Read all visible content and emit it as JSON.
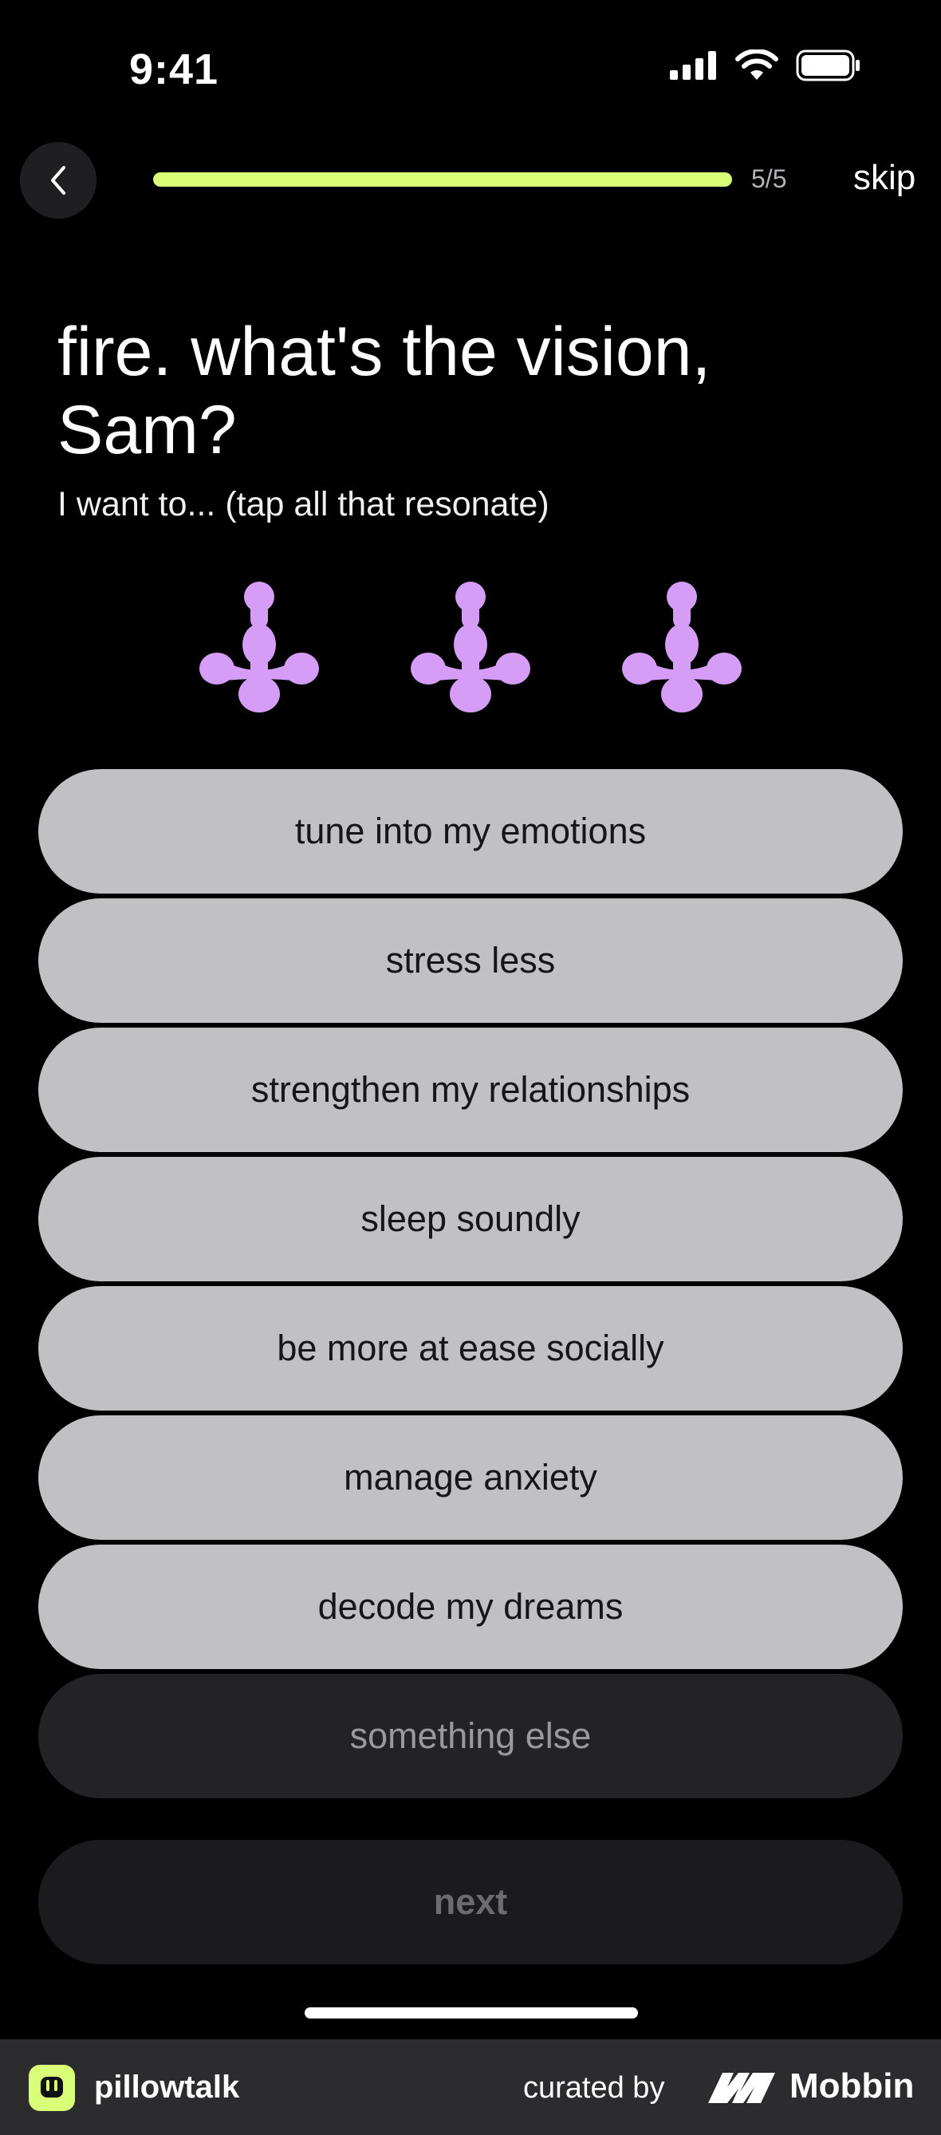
{
  "status_bar": {
    "time": "9:41"
  },
  "header": {
    "progress_text": "5/5",
    "progress_fraction": 1.0,
    "skip_label": "skip"
  },
  "main": {
    "title": "fire. what's the vision, Sam?",
    "subtitle": "I want to... (tap all that resonate)",
    "options": [
      "tune into my emotions",
      "stress less",
      "strengthen my relationships",
      "sleep soundly",
      "be more at ease socially",
      "manage anxiety",
      "decode my dreams",
      "something else"
    ],
    "next_label": "next"
  },
  "footer": {
    "app_name": "pillowtalk",
    "curated_label": "curated by",
    "brand": "Mobbin"
  },
  "colors": {
    "accent": "#d9ff79",
    "mascot": "#d59df6",
    "option_bg": "#c1c0c3",
    "option_dark_bg": "#232325"
  },
  "icons": [
    "back-chevron-icon",
    "signal-icon",
    "wifi-icon",
    "battery-icon",
    "mascot-icon",
    "pillowtalk-logo-icon",
    "mobbin-logo-icon"
  ]
}
